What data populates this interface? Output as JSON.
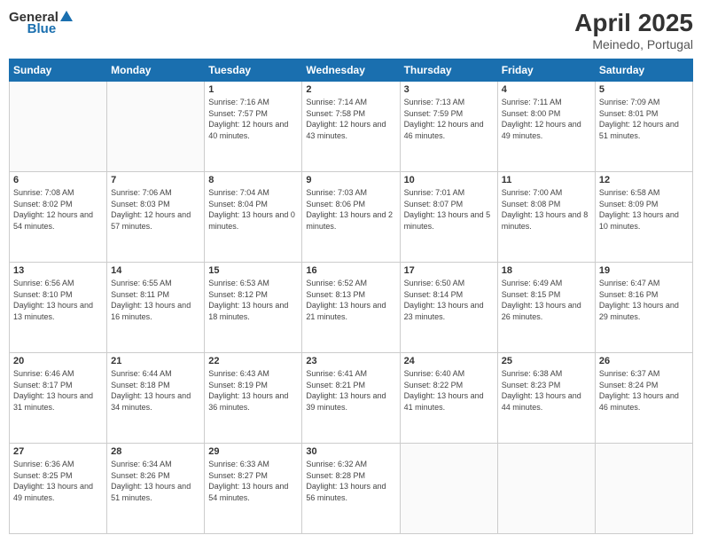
{
  "header": {
    "logo_general": "General",
    "logo_blue": "Blue",
    "title": "April 2025",
    "location": "Meinedo, Portugal"
  },
  "weekdays": [
    "Sunday",
    "Monday",
    "Tuesday",
    "Wednesday",
    "Thursday",
    "Friday",
    "Saturday"
  ],
  "weeks": [
    [
      {
        "day": "",
        "info": ""
      },
      {
        "day": "",
        "info": ""
      },
      {
        "day": "1",
        "info": "Sunrise: 7:16 AM\nSunset: 7:57 PM\nDaylight: 12 hours and 40 minutes."
      },
      {
        "day": "2",
        "info": "Sunrise: 7:14 AM\nSunset: 7:58 PM\nDaylight: 12 hours and 43 minutes."
      },
      {
        "day": "3",
        "info": "Sunrise: 7:13 AM\nSunset: 7:59 PM\nDaylight: 12 hours and 46 minutes."
      },
      {
        "day": "4",
        "info": "Sunrise: 7:11 AM\nSunset: 8:00 PM\nDaylight: 12 hours and 49 minutes."
      },
      {
        "day": "5",
        "info": "Sunrise: 7:09 AM\nSunset: 8:01 PM\nDaylight: 12 hours and 51 minutes."
      }
    ],
    [
      {
        "day": "6",
        "info": "Sunrise: 7:08 AM\nSunset: 8:02 PM\nDaylight: 12 hours and 54 minutes."
      },
      {
        "day": "7",
        "info": "Sunrise: 7:06 AM\nSunset: 8:03 PM\nDaylight: 12 hours and 57 minutes."
      },
      {
        "day": "8",
        "info": "Sunrise: 7:04 AM\nSunset: 8:04 PM\nDaylight: 13 hours and 0 minutes."
      },
      {
        "day": "9",
        "info": "Sunrise: 7:03 AM\nSunset: 8:06 PM\nDaylight: 13 hours and 2 minutes."
      },
      {
        "day": "10",
        "info": "Sunrise: 7:01 AM\nSunset: 8:07 PM\nDaylight: 13 hours and 5 minutes."
      },
      {
        "day": "11",
        "info": "Sunrise: 7:00 AM\nSunset: 8:08 PM\nDaylight: 13 hours and 8 minutes."
      },
      {
        "day": "12",
        "info": "Sunrise: 6:58 AM\nSunset: 8:09 PM\nDaylight: 13 hours and 10 minutes."
      }
    ],
    [
      {
        "day": "13",
        "info": "Sunrise: 6:56 AM\nSunset: 8:10 PM\nDaylight: 13 hours and 13 minutes."
      },
      {
        "day": "14",
        "info": "Sunrise: 6:55 AM\nSunset: 8:11 PM\nDaylight: 13 hours and 16 minutes."
      },
      {
        "day": "15",
        "info": "Sunrise: 6:53 AM\nSunset: 8:12 PM\nDaylight: 13 hours and 18 minutes."
      },
      {
        "day": "16",
        "info": "Sunrise: 6:52 AM\nSunset: 8:13 PM\nDaylight: 13 hours and 21 minutes."
      },
      {
        "day": "17",
        "info": "Sunrise: 6:50 AM\nSunset: 8:14 PM\nDaylight: 13 hours and 23 minutes."
      },
      {
        "day": "18",
        "info": "Sunrise: 6:49 AM\nSunset: 8:15 PM\nDaylight: 13 hours and 26 minutes."
      },
      {
        "day": "19",
        "info": "Sunrise: 6:47 AM\nSunset: 8:16 PM\nDaylight: 13 hours and 29 minutes."
      }
    ],
    [
      {
        "day": "20",
        "info": "Sunrise: 6:46 AM\nSunset: 8:17 PM\nDaylight: 13 hours and 31 minutes."
      },
      {
        "day": "21",
        "info": "Sunrise: 6:44 AM\nSunset: 8:18 PM\nDaylight: 13 hours and 34 minutes."
      },
      {
        "day": "22",
        "info": "Sunrise: 6:43 AM\nSunset: 8:19 PM\nDaylight: 13 hours and 36 minutes."
      },
      {
        "day": "23",
        "info": "Sunrise: 6:41 AM\nSunset: 8:21 PM\nDaylight: 13 hours and 39 minutes."
      },
      {
        "day": "24",
        "info": "Sunrise: 6:40 AM\nSunset: 8:22 PM\nDaylight: 13 hours and 41 minutes."
      },
      {
        "day": "25",
        "info": "Sunrise: 6:38 AM\nSunset: 8:23 PM\nDaylight: 13 hours and 44 minutes."
      },
      {
        "day": "26",
        "info": "Sunrise: 6:37 AM\nSunset: 8:24 PM\nDaylight: 13 hours and 46 minutes."
      }
    ],
    [
      {
        "day": "27",
        "info": "Sunrise: 6:36 AM\nSunset: 8:25 PM\nDaylight: 13 hours and 49 minutes."
      },
      {
        "day": "28",
        "info": "Sunrise: 6:34 AM\nSunset: 8:26 PM\nDaylight: 13 hours and 51 minutes."
      },
      {
        "day": "29",
        "info": "Sunrise: 6:33 AM\nSunset: 8:27 PM\nDaylight: 13 hours and 54 minutes."
      },
      {
        "day": "30",
        "info": "Sunrise: 6:32 AM\nSunset: 8:28 PM\nDaylight: 13 hours and 56 minutes."
      },
      {
        "day": "",
        "info": ""
      },
      {
        "day": "",
        "info": ""
      },
      {
        "day": "",
        "info": ""
      }
    ]
  ]
}
